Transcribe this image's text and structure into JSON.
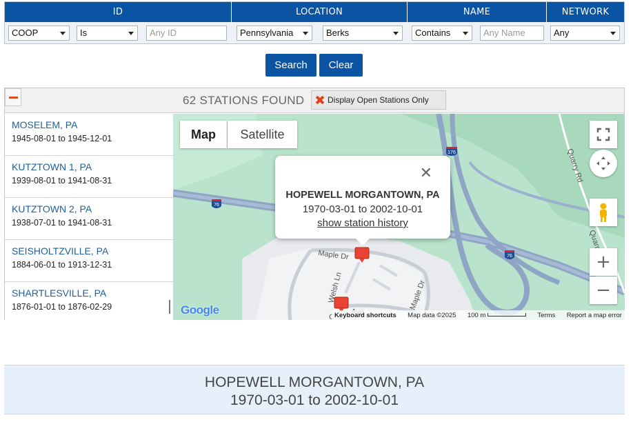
{
  "filters": {
    "headers": {
      "id": "ID",
      "location": "LOCATION",
      "name": "NAME",
      "network": "NETWORK"
    },
    "id_network_select": "COOP",
    "id_operator_select": "Is",
    "id_input_placeholder": "Any ID",
    "state_select": "Pennsylvania",
    "county_select": "Berks",
    "name_operator_select": "Contains",
    "name_input_placeholder": "Any Name",
    "network_select": "Any"
  },
  "buttons": {
    "search": "Search",
    "clear": "Clear"
  },
  "results": {
    "count_label": "62 STATIONS FOUND",
    "open_only_label": "Display Open Stations Only",
    "stations": [
      {
        "name": "MOSELEM, PA",
        "dates": "1945-08-01 to 1945-12-01"
      },
      {
        "name": "KUTZTOWN 1, PA",
        "dates": "1939-08-01 to 1941-08-31"
      },
      {
        "name": "KUTZTOWN 2, PA",
        "dates": "1938-07-01 to 1941-08-31"
      },
      {
        "name": "SEISHOLTZVILLE, PA",
        "dates": "1884-06-01 to 1913-12-31"
      },
      {
        "name": "SHARTLESVILLE, PA",
        "dates": "1876-01-01 to 1876-02-29"
      }
    ]
  },
  "map": {
    "map_tab": "Map",
    "satellite_tab": "Satellite",
    "popup": {
      "title": "HOPEWELL MORGANTOWN, PA",
      "dates": "1970-03-01 to 2002-10-01",
      "history_link": "show station history"
    },
    "labels": {
      "maple_dr": "Maple Dr",
      "maple_dr_2": "Maple Dr",
      "welsh_ln": "Welsh Ln",
      "quarry_rd": "Quarry Rd",
      "quarry_rd_2": "Quarry",
      "c_ave": "C",
      "c_ave_2": "Ave",
      "i76_a": "76",
      "i76_b": "76",
      "i176": "176"
    },
    "attribution": {
      "keyboard": "Keyboard shortcuts",
      "data": "Map data ©2025",
      "scale": "100 m",
      "terms": "Terms",
      "report": "Report a map error"
    },
    "google_logo": "Google",
    "colors": {
      "land": "#b9e3cc",
      "urban": "#e8eaed",
      "highway": "#8fa5c6",
      "marker": "#ea4335"
    }
  },
  "selected": {
    "title": "HOPEWELL MORGANTOWN, PA",
    "dates": "1970-03-01 to 2002-10-01"
  },
  "theme": {
    "primary": "#0b53a3",
    "link": "#1d5f9e",
    "accent_red": "#e24a1b"
  }
}
